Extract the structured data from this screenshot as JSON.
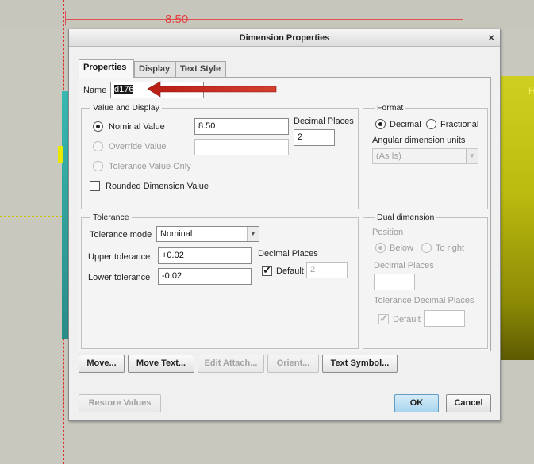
{
  "background": {
    "dimension_text": "8.50",
    "model_label": "H"
  },
  "dialog": {
    "title": "Dimension Properties",
    "close_glyph": "×",
    "tabs": [
      {
        "label": "Properties",
        "active": true
      },
      {
        "label": "Display",
        "active": false
      },
      {
        "label": "Text Style",
        "active": false
      }
    ],
    "name": {
      "label": "Name",
      "value": "d176"
    },
    "value_display": {
      "title": "Value and Display",
      "nominal_value": {
        "label": "Nominal Value",
        "value": "8.50",
        "selected": true
      },
      "override_value": {
        "label": "Override Value",
        "value": ""
      },
      "tolerance_value_only": {
        "label": "Tolerance Value Only"
      },
      "rounded_dimension_value": {
        "label": "Rounded Dimension Value",
        "checked": false
      },
      "decimal_places": {
        "label": "Decimal Places",
        "value": "2"
      }
    },
    "format": {
      "title": "Format",
      "decimal_label": "Decimal",
      "fractional_label": "Fractional",
      "selected": "Decimal",
      "angular_units_label": "Angular dimension units",
      "angular_units_value": "(As Is)"
    },
    "tolerance": {
      "title": "Tolerance",
      "mode_label": "Tolerance mode",
      "mode_value": "Nominal",
      "upper_label": "Upper tolerance",
      "upper_value": "+0.02",
      "lower_label": "Lower tolerance",
      "lower_value": "-0.02",
      "decimal_places_label": "Decimal Places",
      "default_label": "Default",
      "default_checked": true,
      "decimal_places_value": "2"
    },
    "dual_dimension": {
      "title": "Dual dimension",
      "position_label": "Position",
      "below_label": "Below",
      "to_right_label": "To right",
      "decimal_places_label": "Decimal Places",
      "tolerance_decimal_label": "Tolerance Decimal Places",
      "default_label": "Default"
    },
    "action_buttons": {
      "move": "Move...",
      "move_text": "Move Text...",
      "edit_attach": "Edit Attach...",
      "orient": "Orient...",
      "text_symbol": "Text Symbol..."
    },
    "footer": {
      "restore_values": "Restore Values",
      "ok": "OK",
      "cancel": "Cancel"
    }
  },
  "colors": {
    "annotation_arrow": "#c0281e",
    "model_yellow": "#c4c418",
    "dimension_red": "#e04040"
  }
}
